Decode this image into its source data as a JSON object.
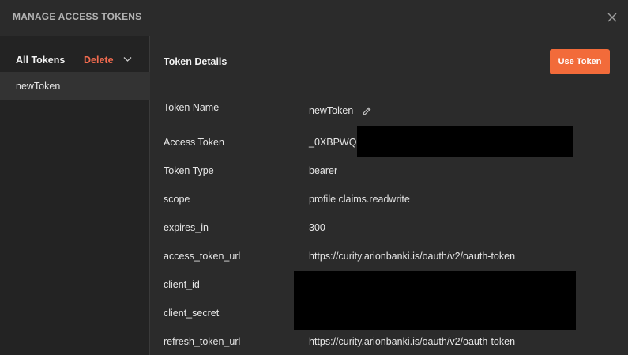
{
  "header": {
    "title": "MANAGE ACCESS TOKENS",
    "close_icon": "close-icon"
  },
  "sidebar": {
    "heading": "All Tokens",
    "delete_label": "Delete",
    "delete_icon": "chevron-down-icon",
    "tokens": [
      {
        "label": "newToken",
        "selected": true
      }
    ]
  },
  "details": {
    "title": "Token Details",
    "use_token_label": "Use Token",
    "accent_color": "#f26b3a",
    "fields": {
      "token_name": {
        "label": "Token Name",
        "value": "newToken"
      },
      "access_token": {
        "label": "Access Token",
        "value": "_0XBPWQC"
      },
      "token_type": {
        "label": "Token Type",
        "value": "bearer"
      },
      "scope": {
        "label": "scope",
        "value": "profile claims.readwrite"
      },
      "expires_in": {
        "label": "expires_in",
        "value": "300"
      },
      "access_token_url": {
        "label": "access_token_url",
        "value": "https://curity.arionbanki.is/oauth/v2/oauth-token"
      },
      "client_id": {
        "label": "client_id",
        "value": ""
      },
      "client_secret": {
        "label": "client_secret",
        "value": ""
      },
      "refresh_token_url": {
        "label": "refresh_token_url",
        "value": "https://curity.arionbanki.is/oauth/v2/oauth-token"
      }
    }
  }
}
